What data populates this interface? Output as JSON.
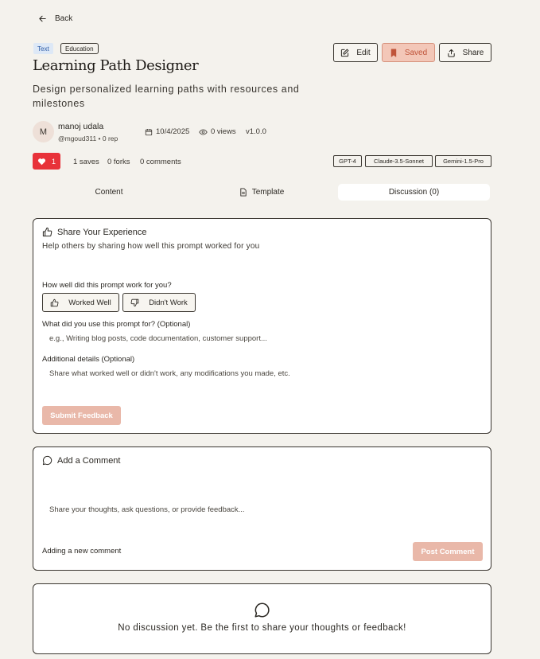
{
  "nav": {
    "back_label": "Back"
  },
  "tags": [
    "Text",
    "Education"
  ],
  "prompt": {
    "title": "Learning Path Designer",
    "description": "Design personalized learning paths with resources and milestones"
  },
  "actions": {
    "edit": "Edit",
    "saved": "Saved",
    "share": "Share"
  },
  "author": {
    "initial": "M",
    "name": "manoj udala",
    "handle": "@mgoud311 • 0 rep"
  },
  "meta": {
    "date": "10/4/2025",
    "views": "0 views",
    "version": "v1.0.0"
  },
  "stats": {
    "likes": "1",
    "saves": "1 saves",
    "forks": "0 forks",
    "comments": "0 comments"
  },
  "models": [
    "GPT-4",
    "Claude-3.5-Sonnet",
    "Gemini-1.5-Pro"
  ],
  "tabs": [
    "Content",
    "Template",
    "Discussion (0)"
  ],
  "feedback": {
    "title": "Share Your Experience",
    "subtitle": "Help others by sharing how well this prompt worked for you",
    "question": "How well did this prompt work for you?",
    "worked": "Worked Well",
    "didnt": "Didn't Work",
    "use_label": "What did you use this prompt for? (Optional)",
    "use_placeholder": "e.g., Writing blog posts, code documentation, customer support...",
    "details_label": "Additional details (Optional)",
    "details_placeholder": "Share what worked well or didn't work, any modifications you made, etc.",
    "submit": "Submit Feedback"
  },
  "comment": {
    "title": "Add a Comment",
    "placeholder": "Share your thoughts, ask questions, or provide feedback...",
    "status": "Adding a new comment",
    "post": "Post Comment"
  },
  "discussion": {
    "empty": "No discussion yet. Be the first to share your thoughts or feedback!"
  },
  "colors": {
    "like": "#e8323a",
    "saved_bg": "#f3c7b8",
    "saved_text": "#c0543a",
    "submit_bg": "#e9b8a9",
    "page_bg": "#f4f2ed",
    "tag_text_bg": "#dde8f6"
  }
}
